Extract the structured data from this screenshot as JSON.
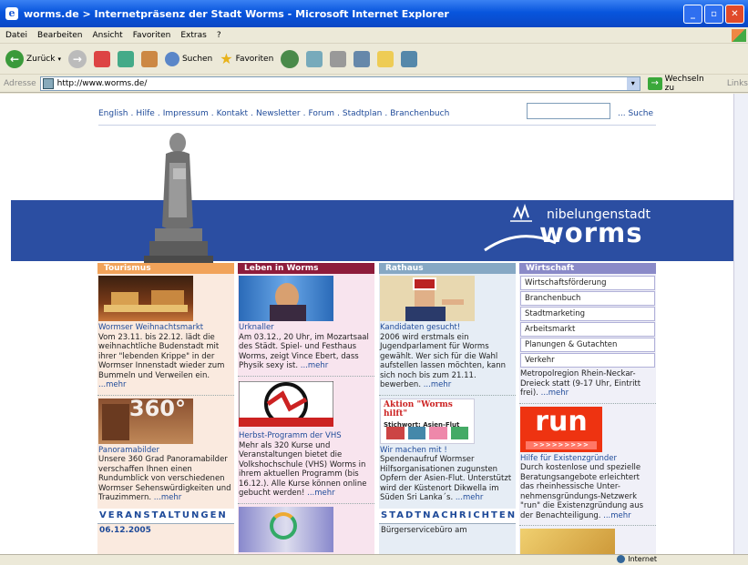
{
  "window": {
    "title": "worms.de > Internetpräsenz der Stadt Worms - Microsoft Internet Explorer"
  },
  "menu": [
    "Datei",
    "Bearbeiten",
    "Ansicht",
    "Favoriten",
    "Extras",
    "?"
  ],
  "toolbar": {
    "back": "Zurück",
    "search": "Suchen",
    "favorites": "Favoriten"
  },
  "address": {
    "label": "Adresse",
    "url": "http://www.worms.de/",
    "go": "Wechseln zu",
    "links": "Links"
  },
  "status": {
    "zone": "Internet"
  },
  "page": {
    "nav": [
      "English",
      "Hilfe",
      "Impressum",
      "Kontakt",
      "Newsletter",
      "Forum",
      "Stadtplan",
      "Branchenbuch"
    ],
    "nav_sep": ".",
    "search_link": "... Suche",
    "logo_top": "nibelungenstadt",
    "logo_main": "worms",
    "col1": {
      "header": "Tourismus",
      "item1": {
        "title": "Wormser Weihnachtsmarkt",
        "text": "Vom 23.11. bis 22.12. lädt die weihnachtliche Budenstadt mit ihrer \"lebenden Krippe\" in der Wormser Innenstadt wieder zum Bummeln und Verweilen ein.",
        "more": "...mehr"
      },
      "item2": {
        "title": "Panoramabilder",
        "text": "Unsere 360 Grad Panoramabilder verschaffen Ihnen einen Rundumblick von verschiedenen Wormser Sehenswürdigkeiten und Trauzimmern.",
        "more": "...mehr"
      },
      "thumb2_label": "360°",
      "section": "VERANSTALTUNGEN",
      "date": "06.12.2005"
    },
    "col2": {
      "header": "Leben in Worms",
      "item1": {
        "title": "Urknaller",
        "text": "Am 03.12., 20 Uhr, im Mozartsaal des Städt. Spiel- und Festhaus Worms, zeigt Vince Ebert, dass Physik sexy ist.",
        "more": "...mehr"
      },
      "item2": {
        "title": "Herbst-Programm der VHS",
        "text": "Mehr als 320 Kurse und Veranstaltungen bietet die Volkshochschule (VHS) Worms in ihrem aktuellen Programm (bis 16.12.). Alle Kurse können online gebucht werden!",
        "more": "...mehr"
      }
    },
    "col3": {
      "header": "Rathaus",
      "item1": {
        "title": "Kandidaten gesucht!",
        "text": "2006 wird erstmals ein Jugendparlament für Worms gewählt. Wer sich für die Wahl aufstellen lassen möchten, kann sich noch bis zum 21.11. bewerben.",
        "more": "...mehr"
      },
      "thumb2_title": "Aktion \"Worms hilft\"",
      "thumb2_sub": "Stichwort: Asien-Flut",
      "item2": {
        "title": "Wir machen mit !",
        "text": "Spendenaufruf Wormser Hilfsorganisationen zugunsten Opfern der Asien-Flut. Unterstützt wird der Küstenort Dikwella im Süden Sri Lanka´s.",
        "more": "...mehr"
      },
      "section": "STADTNACHRICHTEN",
      "news": "Bürgerservicebüro am"
    },
    "col4": {
      "header": "Wirtschaft",
      "menu": [
        "Wirtschaftsförderung",
        "Branchenbuch",
        "Stadtmarketing",
        "Arbeitsmarkt",
        "Planungen & Gutachten",
        "Verkehr"
      ],
      "item1_text": "Metropolregion Rhein-Neckar-Dreieck statt (9-17 Uhr, Eintritt frei).",
      "item1_more": "...mehr",
      "run_label": "run",
      "run_sub": ">>>>>>>>>",
      "item2": {
        "title": "Hilfe für Existenzgründer",
        "text": "Durch kostenlose und spezielle Beratungsangebote erleichtert das rheinhessische Unter-nehmensgründungs-Netzwerk \"run\" die Existenzgründung aus der Benachteiligung.",
        "more": "...mehr"
      }
    }
  }
}
